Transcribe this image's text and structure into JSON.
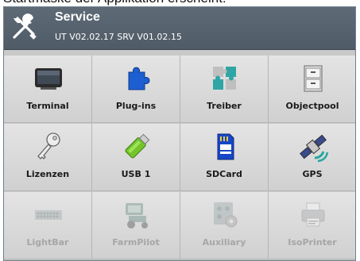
{
  "caption_text": "Startmaske der Applikation erscheint:",
  "header": {
    "title": "Service",
    "version": "UT V02.02.17  SRV V01.02.15",
    "icon": "tools-icon"
  },
  "tiles": [
    {
      "label": "Terminal",
      "icon": "terminal-icon",
      "enabled": true
    },
    {
      "label": "Plug-ins",
      "icon": "puzzle-piece-icon",
      "enabled": true
    },
    {
      "label": "Treiber",
      "icon": "puzzle-pieces-icon",
      "enabled": true
    },
    {
      "label": "Objectpool",
      "icon": "filing-cabinet-icon",
      "enabled": true
    },
    {
      "label": "Lizenzen",
      "icon": "key-icon",
      "enabled": true
    },
    {
      "label": "USB 1",
      "icon": "usb-stick-icon",
      "enabled": true
    },
    {
      "label": "SDCard",
      "icon": "sd-card-icon",
      "enabled": true
    },
    {
      "label": "GPS",
      "icon": "satellite-icon",
      "enabled": true
    },
    {
      "label": "LightBar",
      "icon": "lightbar-icon",
      "enabled": false
    },
    {
      "label": "FarmPilot",
      "icon": "tractor-icon",
      "enabled": false
    },
    {
      "label": "Auxiliary",
      "icon": "auxiliary-icon",
      "enabled": false
    },
    {
      "label": "IsoPrinter",
      "icon": "printer-icon",
      "enabled": false
    }
  ]
}
